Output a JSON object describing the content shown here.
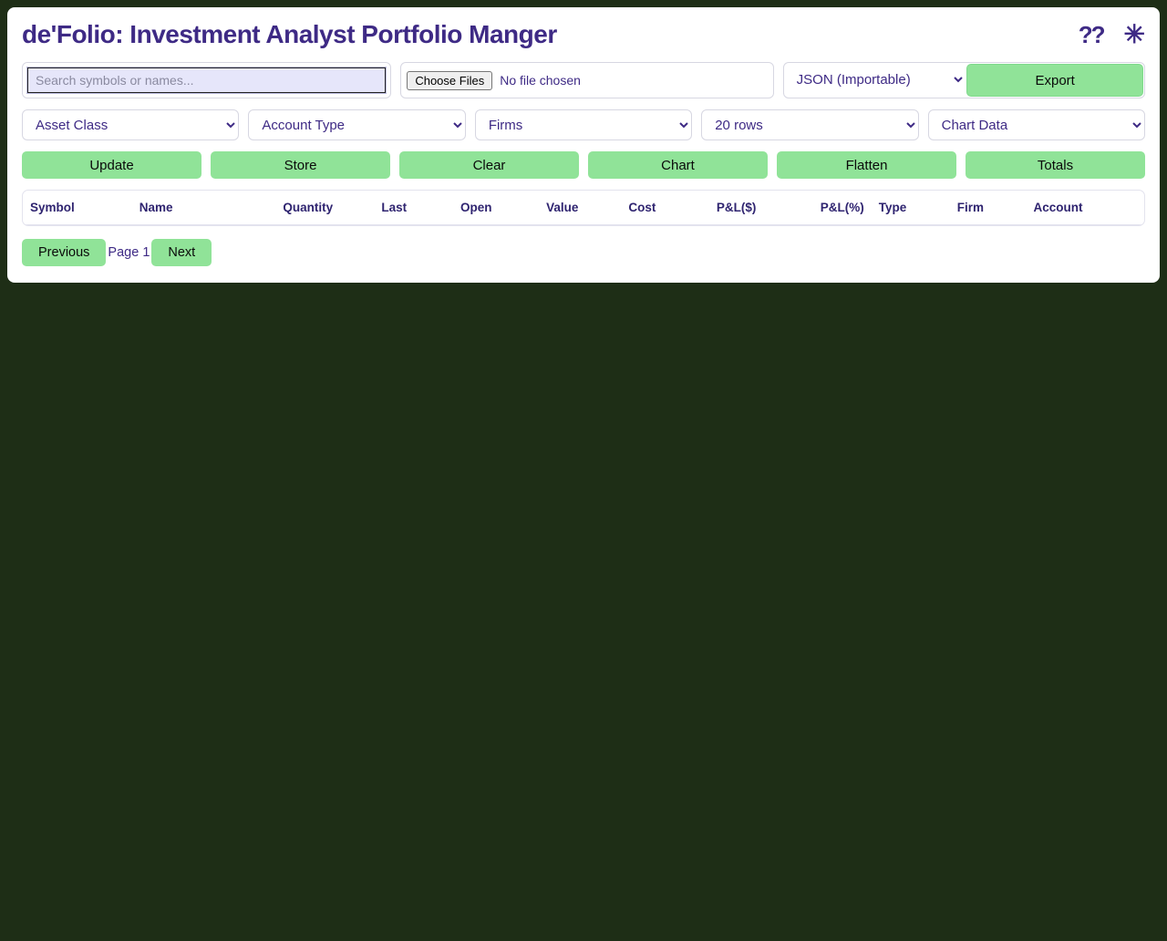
{
  "header": {
    "title": "de'Folio: Investment Analyst Portfolio Manger",
    "help_icon": "??",
    "star_icon": "✳"
  },
  "search": {
    "placeholder": "Search symbols or names..."
  },
  "file": {
    "choose_label": "Choose Files",
    "status": "No file chosen"
  },
  "export": {
    "format_selected": "JSON (Importable)",
    "button_label": "Export"
  },
  "filters": {
    "asset_class": "Asset Class",
    "account_type": "Account Type",
    "firms": "Firms",
    "rows": "20 rows",
    "chart_data": "Chart Data"
  },
  "actions": {
    "update": "Update",
    "store": "Store",
    "clear": "Clear",
    "chart": "Chart",
    "flatten": "Flatten",
    "totals": "Totals"
  },
  "table": {
    "columns": {
      "symbol": "Symbol",
      "name": "Name",
      "quantity": "Quantity",
      "last": "Last",
      "open": "Open",
      "value": "Value",
      "cost": "Cost",
      "pnl_dollar": "P&L($)",
      "pnl_percent": "P&L(%)",
      "type": "Type",
      "firm": "Firm",
      "account": "Account"
    }
  },
  "pagination": {
    "previous": "Previous",
    "page_label": "Page 1",
    "next": "Next"
  }
}
